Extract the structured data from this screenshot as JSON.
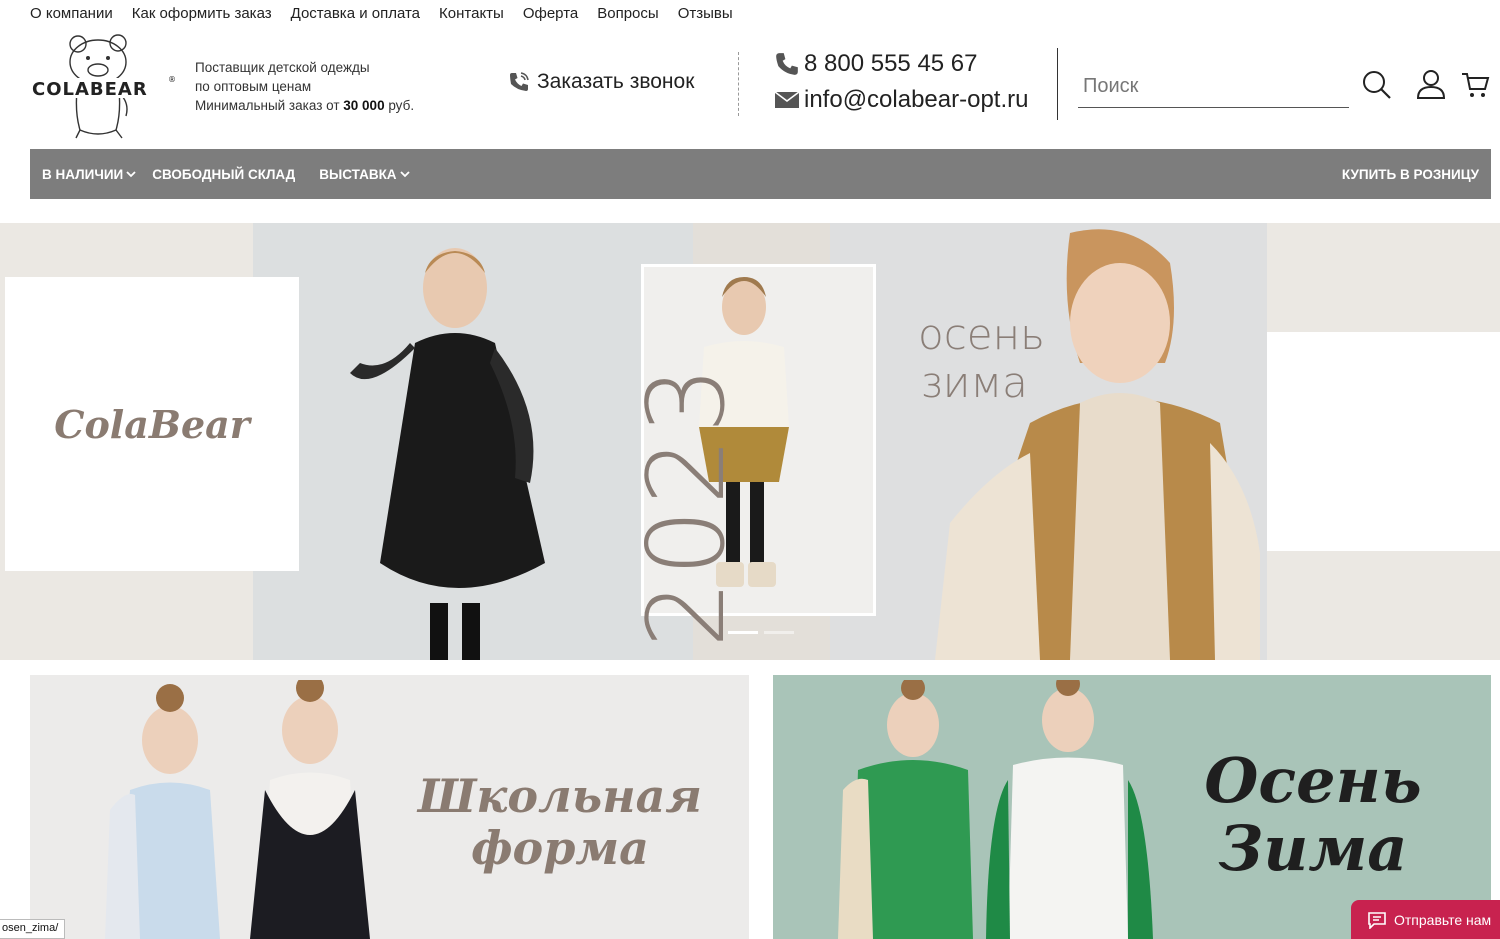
{
  "top_links": [
    "О компании",
    "Как оформить заказ",
    "Доставка и оплата",
    "Контакты",
    "Оферта",
    "Вопросы",
    "Отзывы"
  ],
  "header": {
    "logo_text": "COLABEAR",
    "tagline_1": "Поставщик детской одежды",
    "tagline_2": "по оптовым ценам",
    "min_order_prefix": "Минимальный заказ от ",
    "min_order_amount": "30 000",
    "min_order_suffix": " руб.",
    "callback_label": "Заказать звонок",
    "phone": "8 800 555 45 67",
    "email": "info@colabear-opt.ru",
    "search_placeholder": "Поиск"
  },
  "nav": {
    "in_stock": "В НАЛИЧИИ",
    "free_warehouse": "СВОБОДНЫЙ СКЛАД",
    "exhibition": "ВЫСТАВКА",
    "retail": "КУПИТЬ В РОЗНИЦУ"
  },
  "hero": {
    "brand": "ColaBear",
    "year": "2023",
    "season_1": "осень",
    "season_2": "зима",
    "slides": 2,
    "active_slide": 1
  },
  "banners": {
    "school_1": "Школьная",
    "school_2": "форма",
    "autumn_1": "Осень",
    "autumn_2": "Зима"
  },
  "status_url": "osen_zima/",
  "chat_label": "Отправьте нам",
  "colors": {
    "nav_bg": "#7d7d7d",
    "accent_chat": "#c8224f",
    "hero_text": "#8a7e77"
  }
}
